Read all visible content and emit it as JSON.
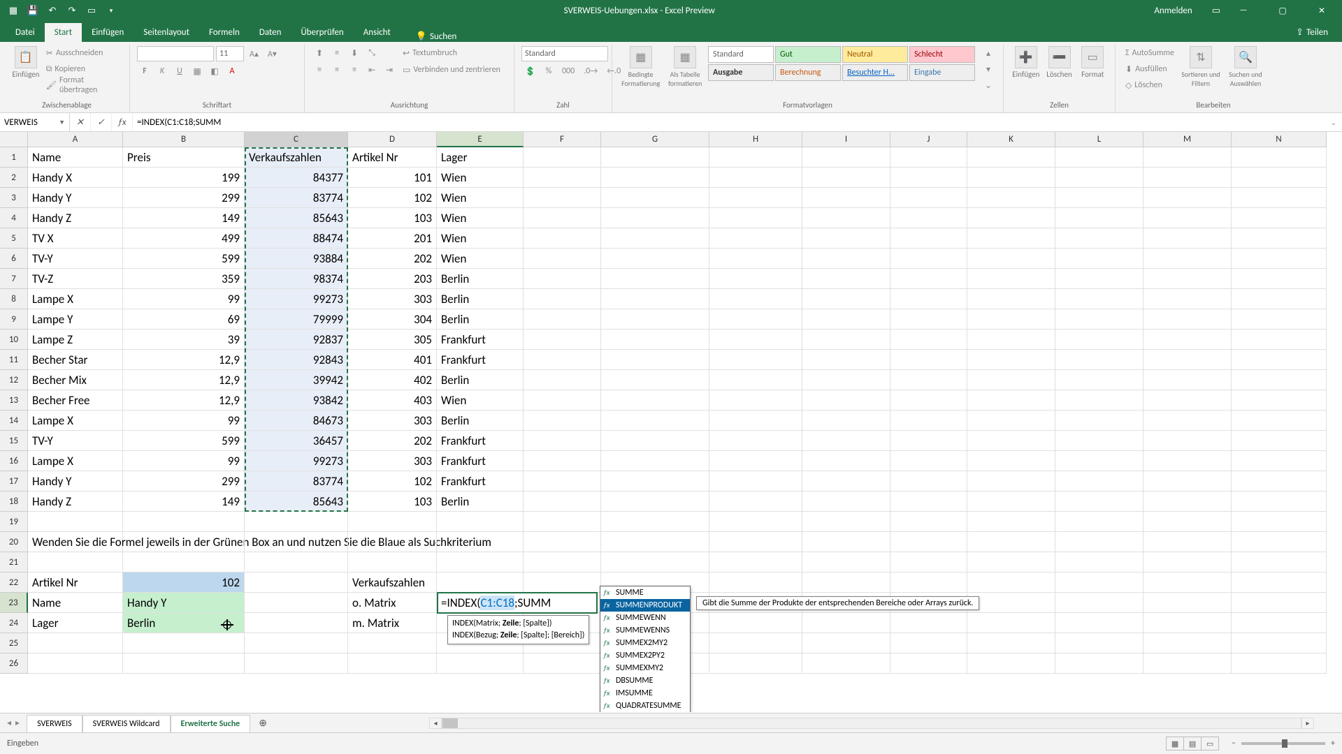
{
  "app": {
    "title": "SVERWEIS-Uebungen.xlsx - Excel Preview",
    "signin": "Anmelden"
  },
  "tabs": {
    "items": [
      "Datei",
      "Start",
      "Einfügen",
      "Seitenlayout",
      "Formeln",
      "Daten",
      "Überprüfen",
      "Ansicht"
    ],
    "active": 1,
    "search": "Suchen",
    "share": "Teilen"
  },
  "ribbon": {
    "clipboard": {
      "label": "Zwischenablage",
      "paste": "Einfügen",
      "cut": "Ausschneiden",
      "copy": "Kopieren",
      "painter": "Format übertragen"
    },
    "font": {
      "label": "Schriftart",
      "name": "",
      "size": "11"
    },
    "alignment": {
      "label": "Ausrichtung",
      "wrap": "Textumbruch",
      "merge": "Verbinden und zentrieren"
    },
    "number": {
      "label": "Zahl",
      "format": "Standard"
    },
    "styles": {
      "label": "Formatvorlagen",
      "cond": "Bedingte Formatierung",
      "table": "Als Tabelle formatieren",
      "cells": [
        "Standard",
        "Gut",
        "Neutral",
        "Schlecht",
        "Ausgabe",
        "Berechnung",
        "Besuchter H...",
        "Eingabe"
      ]
    },
    "cells": {
      "label": "Zellen",
      "insert": "Einfügen",
      "delete": "Löschen",
      "format": "Format"
    },
    "editing": {
      "label": "Bearbeiten",
      "autosum": "AutoSumme",
      "fill": "Ausfüllen",
      "clear": "Löschen",
      "sort": "Sortieren und Filtern",
      "find": "Suchen und Auswählen"
    }
  },
  "fx": {
    "namebox": "VERWEIS",
    "formula": "=INDEX(C1:C18;SUMM"
  },
  "columns": [
    "A",
    "B",
    "C",
    "D",
    "E",
    "F",
    "G",
    "H",
    "I",
    "J",
    "K",
    "L",
    "M",
    "N"
  ],
  "rowcount": 26,
  "headers": {
    "A": "Name",
    "B": "Preis",
    "C": "Verkaufszahlen",
    "D": "Artikel Nr",
    "E": "Lager"
  },
  "data": [
    {
      "A": "Handy X",
      "B": "199",
      "C": "84377",
      "D": "101",
      "E": "Wien"
    },
    {
      "A": "Handy Y",
      "B": "299",
      "C": "83774",
      "D": "102",
      "E": "Wien"
    },
    {
      "A": "Handy Z",
      "B": "149",
      "C": "85643",
      "D": "103",
      "E": "Wien"
    },
    {
      "A": "TV X",
      "B": "499",
      "C": "88474",
      "D": "201",
      "E": "Wien"
    },
    {
      "A": "TV-Y",
      "B": "599",
      "C": "93884",
      "D": "202",
      "E": "Wien"
    },
    {
      "A": "TV-Z",
      "B": "359",
      "C": "98374",
      "D": "203",
      "E": "Berlin"
    },
    {
      "A": "Lampe X",
      "B": "99",
      "C": "99273",
      "D": "303",
      "E": "Berlin"
    },
    {
      "A": "Lampe Y",
      "B": "69",
      "C": "79999",
      "D": "304",
      "E": "Berlin"
    },
    {
      "A": "Lampe Z",
      "B": "39",
      "C": "92837",
      "D": "305",
      "E": "Frankfurt"
    },
    {
      "A": "Becher Star",
      "B": "12,9",
      "C": "92843",
      "D": "401",
      "E": "Frankfurt"
    },
    {
      "A": "Becher Mix",
      "B": "12,9",
      "C": "39942",
      "D": "402",
      "E": "Berlin"
    },
    {
      "A": "Becher Free",
      "B": "12,9",
      "C": "93842",
      "D": "403",
      "E": "Wien"
    },
    {
      "A": "Lampe X",
      "B": "99",
      "C": "84673",
      "D": "303",
      "E": "Berlin"
    },
    {
      "A": "TV-Y",
      "B": "599",
      "C": "36457",
      "D": "202",
      "E": "Frankfurt"
    },
    {
      "A": "Lampe X",
      "B": "99",
      "C": "99273",
      "D": "303",
      "E": "Frankfurt"
    },
    {
      "A": "Handy Y",
      "B": "299",
      "C": "83774",
      "D": "102",
      "E": "Frankfurt"
    },
    {
      "A": "Handy Z",
      "B": "149",
      "C": "85643",
      "D": "103",
      "E": "Berlin"
    }
  ],
  "row20": "Wenden Sie die Formel jeweils in der Grünen Box an und nutzen Sie die Blaue als Suchkriterium",
  "lookup": {
    "r22": {
      "A": "Artikel Nr",
      "B": "102",
      "D": "Verkaufszahlen"
    },
    "r23": {
      "A": "Name",
      "B": "Handy Y",
      "D": "o. Matrix",
      "E": "=INDEX(C1:C18;SUMM"
    },
    "r24": {
      "A": "Lager",
      "B": "Berlin",
      "D": "m. Matrix"
    }
  },
  "tooltip": {
    "line1": "INDEX(Matrix; ",
    "line1b": "Zeile",
    "line1c": "; [Spalte])",
    "line2": "INDEX(Bezug; ",
    "line2b": "Zeile",
    "line2c": "; [Spalte]; [Bereich])"
  },
  "fnlist": [
    "SUMME",
    "SUMMENPRODUKT",
    "SUMMEWENN",
    "SUMMEWENNS",
    "SUMMEX2MY2",
    "SUMMEX2PY2",
    "SUMMEXMY2",
    "DBSUMME",
    "IMSUMME",
    "QUADRATESUMME"
  ],
  "fnsel": 1,
  "fndesc": "Gibt die Summe der Produkte der entsprechenden Bereiche oder Arrays zurück.",
  "sheets": {
    "items": [
      "SVERWEIS",
      "SVERWEIS Wildcard",
      "Erweiterte Suche"
    ],
    "active": 2
  },
  "status": {
    "mode": "Eingeben",
    "zoom": "100"
  }
}
